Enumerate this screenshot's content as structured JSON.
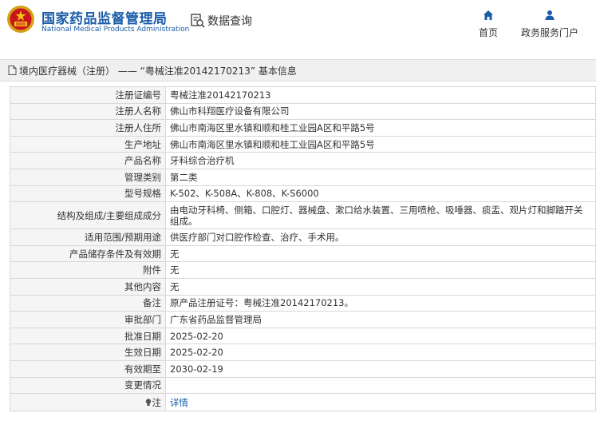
{
  "header": {
    "brand_cn": "国家药品监督管理局",
    "brand_en": "National Medical Products Administration",
    "search_label": "数据查询",
    "nav": [
      {
        "label": "首页",
        "icon": "home-icon"
      },
      {
        "label": "政务服务门户",
        "icon": "user-icon"
      }
    ]
  },
  "page": {
    "title": "境内医疗器械（注册） —— “粤械注准20142170213” 基本信息"
  },
  "details": [
    {
      "key": "注册证编号",
      "value": "粤械注准20142170213"
    },
    {
      "key": "注册人名称",
      "value": "佛山市科翔医疗设备有限公司"
    },
    {
      "key": "注册人住所",
      "value": "佛山市南海区里水镇和顺和桂工业园A区和平路5号"
    },
    {
      "key": "生产地址",
      "value": "佛山市南海区里水镇和顺和桂工业园A区和平路5号"
    },
    {
      "key": "产品名称",
      "value": "牙科综合治疗机"
    },
    {
      "key": "管理类别",
      "value": "第二类"
    },
    {
      "key": "型号规格",
      "value": "K-502、K-508A、K-808、K-S6000"
    },
    {
      "key": "结构及组成/主要组成成分",
      "value": "由电动牙科椅、侧箱、口腔灯、器械盘、漱口给水装置、三用喷枪、吸唾器、痰盂、观片灯和脚踏开关组成。"
    },
    {
      "key": "适用范围/预期用途",
      "value": "供医疗部门对口腔作检查、治疗、手术用。"
    },
    {
      "key": "产品储存条件及有效期",
      "value": "无"
    },
    {
      "key": "附件",
      "value": "无"
    },
    {
      "key": "其他内容",
      "value": "无"
    },
    {
      "key": "备注",
      "value": "原产品注册证号：粤械注准20142170213。"
    },
    {
      "key": "审批部门",
      "value": "广东省药品监督管理局"
    },
    {
      "key": "批准日期",
      "value": "2025-02-20"
    },
    {
      "key": "生效日期",
      "value": "2025-02-20"
    },
    {
      "key": "有效期至",
      "value": "2030-02-19"
    },
    {
      "key": "变更情况",
      "value": ""
    }
  ],
  "note": {
    "key": "注",
    "link_label": "详情",
    "icon": "lightbulb-icon"
  },
  "colors": {
    "brand": "#1a5ca8",
    "key_bg": "#f5f5f5",
    "border": "#d8d8d8",
    "titlebar_bg": "#f0f0f0"
  }
}
